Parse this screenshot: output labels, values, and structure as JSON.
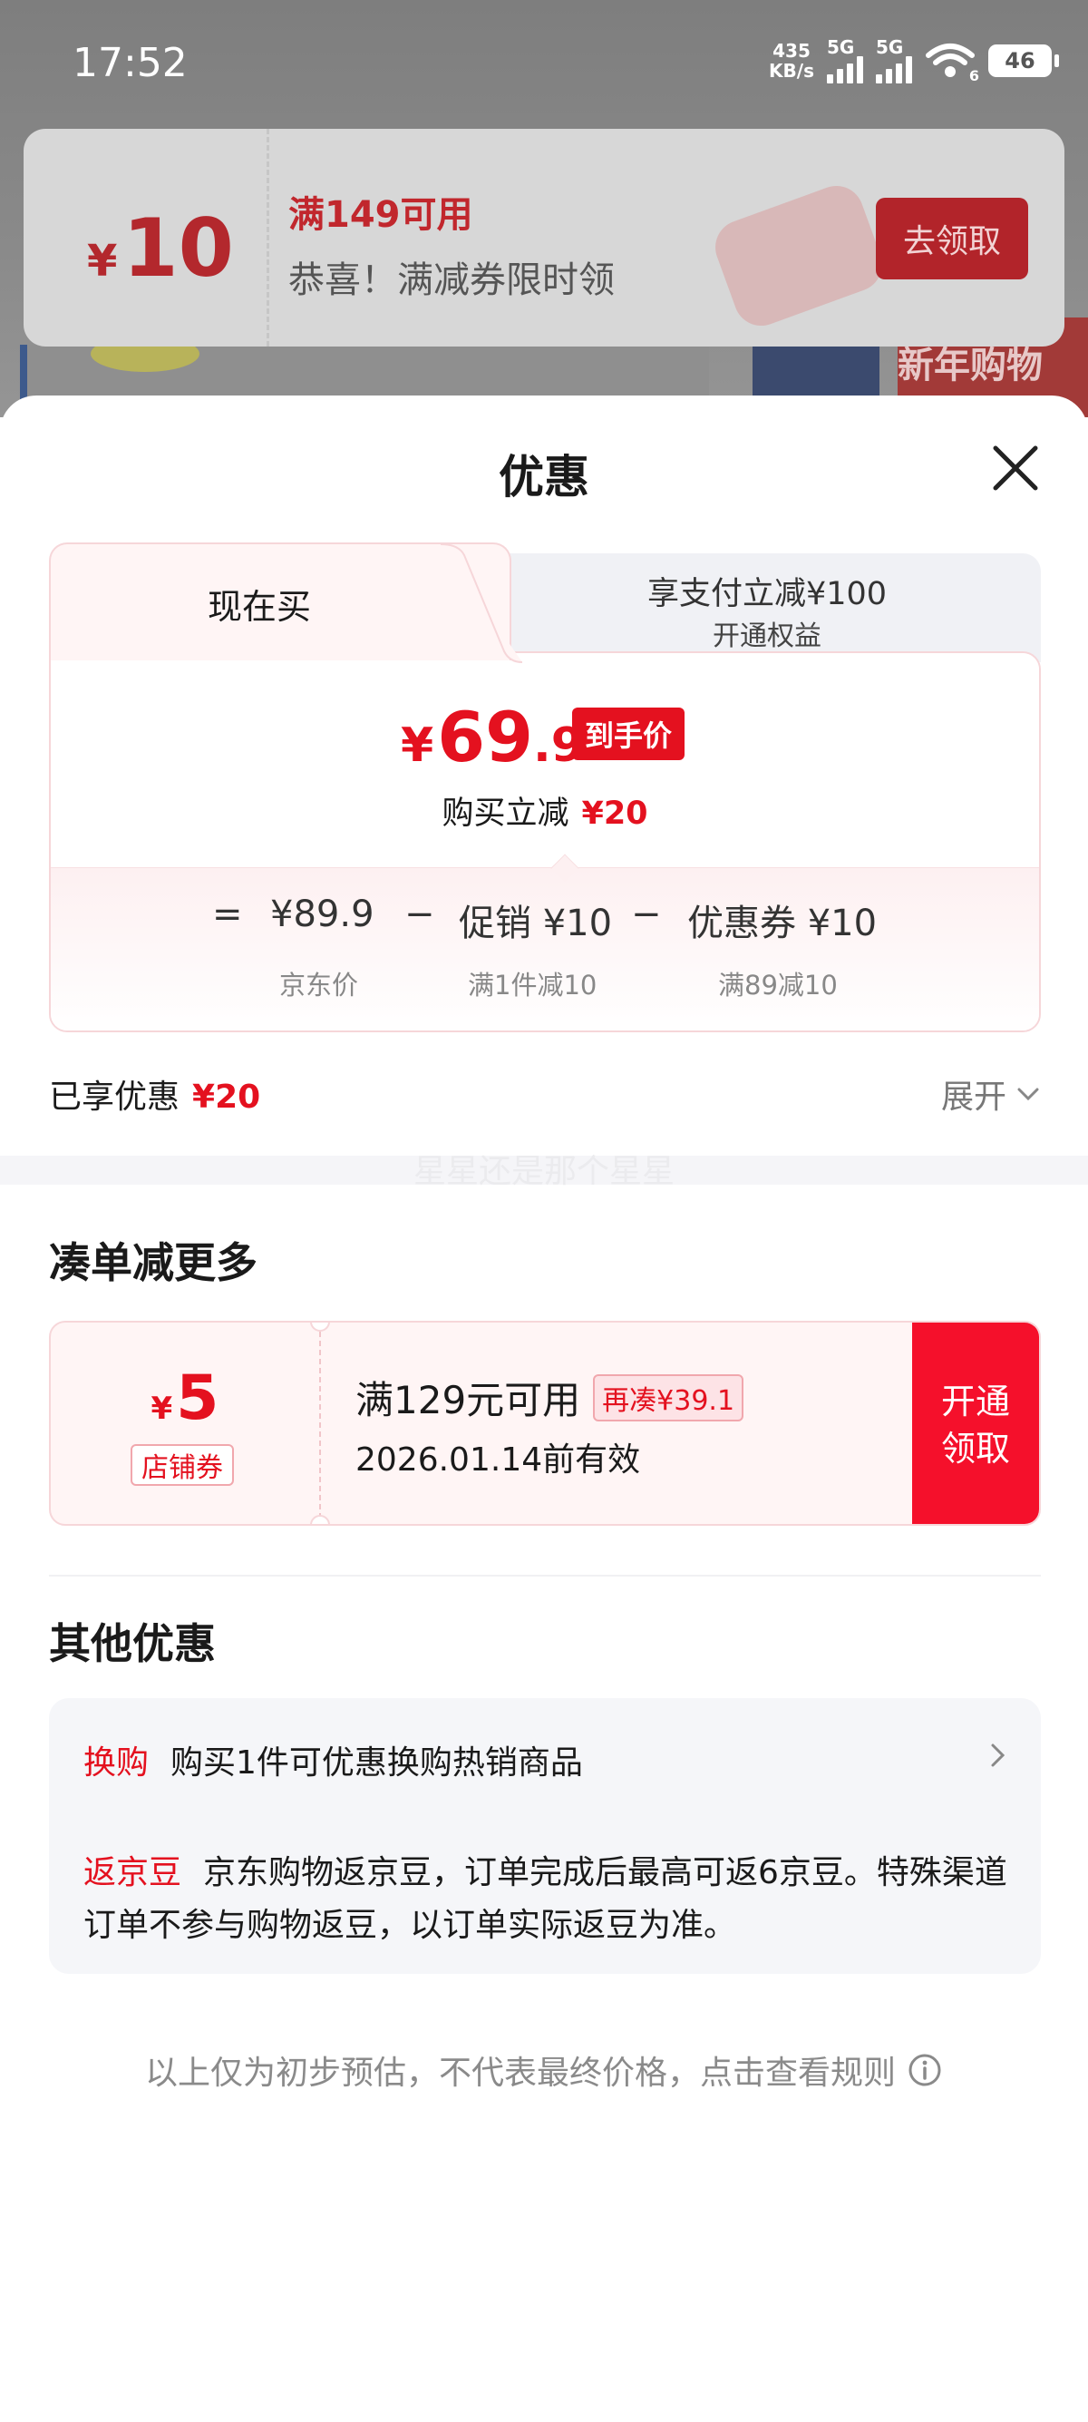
{
  "status_bar": {
    "time": "17:52",
    "net_speed_top": "435",
    "net_speed_bottom": "KB/s",
    "sim1": "5G",
    "sim2": "5G",
    "wifi_badge": "6",
    "battery": "46"
  },
  "background": {
    "banner_text": "新年购物季"
  },
  "coupon_banner": {
    "currency": "¥",
    "amount": "10",
    "title": "满149可用",
    "subtitle": "恭喜！满减券限时领",
    "button": "去领取"
  },
  "sheet": {
    "title": "优惠",
    "tabs": {
      "now": "现在买",
      "other_line1": "享支付立减¥100",
      "other_line2": "开通权益"
    },
    "price": {
      "currency": "¥",
      "integer": "69",
      "decimal": ".9",
      "tag": "到手价",
      "reduce_label": "购买立减",
      "reduce_value": "¥20"
    },
    "formula": {
      "equals": "=",
      "jd_price": "¥89.9",
      "minus1": "−",
      "promo": "促销 ¥10",
      "minus2": "−",
      "coupon": "优惠券 ¥10",
      "jd_price_label": "京东价",
      "promo_label": "满1件减10",
      "coupon_label": "满89减10"
    },
    "enjoyed_label": "已享优惠",
    "enjoyed_value": "¥20",
    "expand_label": "展开",
    "watermark": "星星还是那个星星"
  },
  "combine": {
    "title": "凑单减更多",
    "coupon": {
      "currency": "¥",
      "amount": "5",
      "tag": "店铺券",
      "condition": "满129元可用",
      "add_more": "再凑¥39.1",
      "valid": "2026.01.14前有效",
      "action_line1": "开通",
      "action_line2": "领取"
    }
  },
  "other_offers": {
    "title": "其他优惠",
    "exchange_label": "换购",
    "exchange_text": "购买1件可优惠换购热销商品",
    "beans_label": "返京豆",
    "beans_text": "京东购物返京豆，订单完成后最高可返6京豆。特殊渠道订单不参与购物返豆，以订单实际返豆为准。"
  },
  "footnote": "以上仅为初步预估，不代表最终价格，点击查看规则",
  "colors": {
    "accent_red": "#e4111f",
    "pink_border": "#f6d6d9",
    "coupon_bg": "#fff5f5"
  }
}
